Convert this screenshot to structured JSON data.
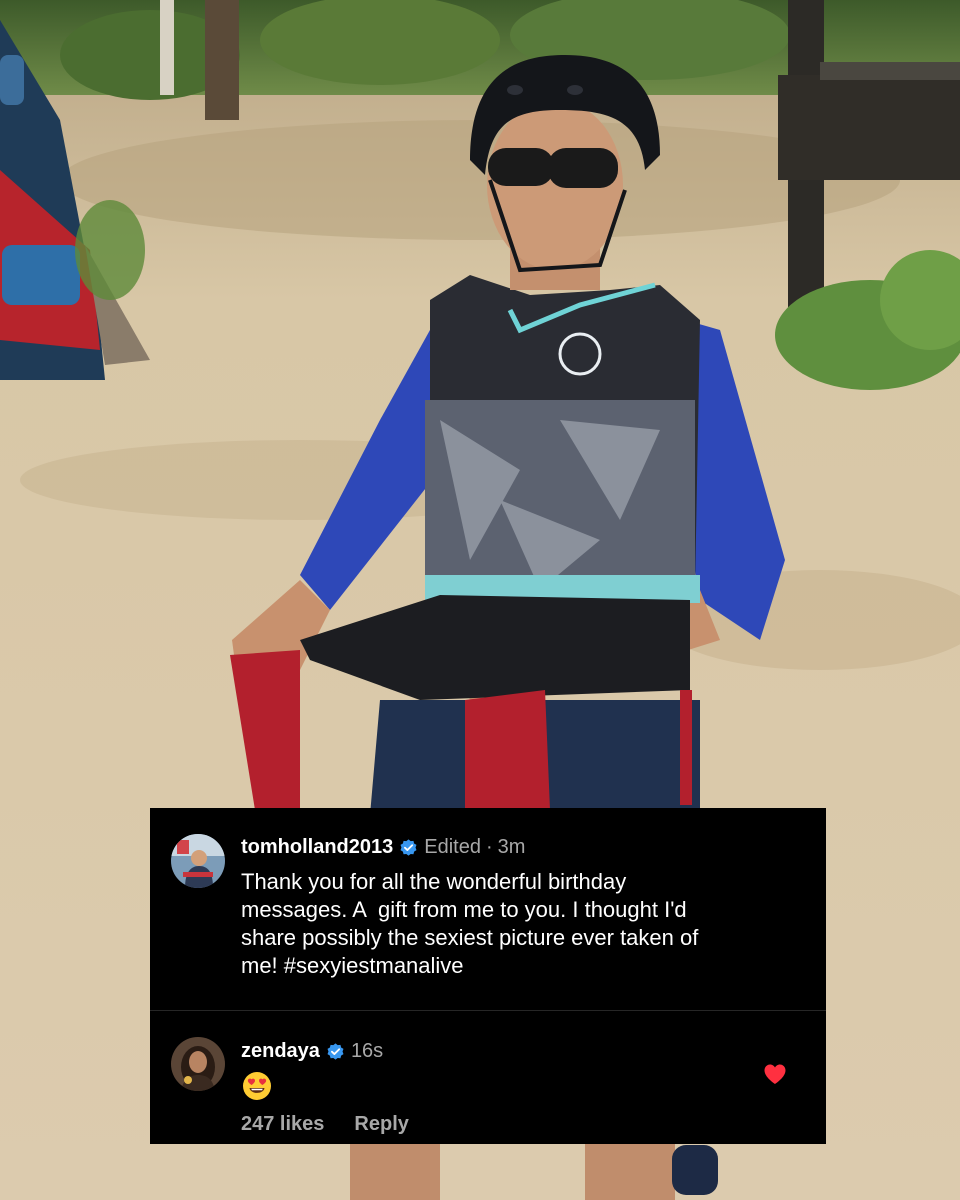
{
  "post": {
    "username": "tomholland2013",
    "verified": true,
    "edited_label": "Edited",
    "time": "3m",
    "caption": "Thank you for all the wonderful birthday\nmessages. A  gift from me to you. I thought I'd\nshare possibly the sexiest picture ever taken of\nme! #sexyiestmanalive"
  },
  "reply": {
    "username": "zendaya",
    "verified": true,
    "time": "16s",
    "content_icon": "heart-eyes-emoji",
    "likes_label": "247 likes",
    "reply_label": "Reply",
    "liked": true
  },
  "colors": {
    "overlay_bg": "#000000",
    "verified_blue": "#3897f0",
    "like_red": "#ff3040",
    "meta_gray": "#a8a8a8"
  }
}
